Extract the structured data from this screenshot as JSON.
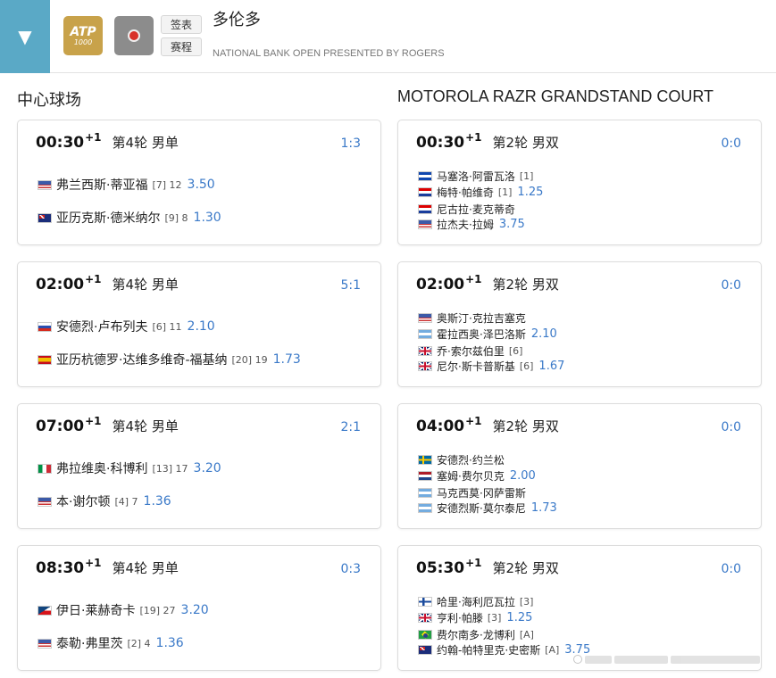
{
  "header": {
    "toggle_icon": "▼",
    "atp_logo_text": "ATP",
    "atp_logo_number": "1000",
    "draw_button": "签表",
    "schedule_button": "赛程",
    "city": "多伦多",
    "tournament": "NATIONAL BANK OPEN PRESENTED BY ROGERS"
  },
  "colors": {
    "accent": "#5aa9c6",
    "link": "#3a79c8",
    "atp_gold": "#c8a24a"
  },
  "courts": [
    {
      "title": "中心球场",
      "matches": [
        {
          "time": "00:30",
          "plus": "+1",
          "round": "第4轮 男单",
          "score": "1:3",
          "players": [
            {
              "flag": "us",
              "name": "弗兰西斯·蒂亚福",
              "seed": "[7] 12",
              "odds": "3.50"
            },
            {
              "flag": "au",
              "name": "亚历克斯·德米纳尔",
              "seed": "[9] 8",
              "odds": "1.30"
            }
          ]
        },
        {
          "time": "02:00",
          "plus": "+1",
          "round": "第4轮 男单",
          "score": "5:1",
          "players": [
            {
              "flag": "ru",
              "name": "安德烈·卢布列夫",
              "seed": "[6] 11",
              "odds": "2.10"
            },
            {
              "flag": "es",
              "name": "亚历杭德罗·达维多维奇-福基纳",
              "seed": "[20] 19",
              "odds": "1.73"
            }
          ]
        },
        {
          "time": "07:00",
          "plus": "+1",
          "round": "第4轮 男单",
          "score": "2:1",
          "players": [
            {
              "flag": "it",
              "name": "弗拉维奥·科博利",
              "seed": "[13] 17",
              "odds": "3.20"
            },
            {
              "flag": "us",
              "name": "本·谢尔顿",
              "seed": "[4] 7",
              "odds": "1.36"
            }
          ]
        },
        {
          "time": "08:30",
          "plus": "+1",
          "round": "第4轮 男单",
          "score": "0:3",
          "players": [
            {
              "flag": "cz",
              "name": "伊日·莱赫奇卡",
              "seed": "[19] 27",
              "odds": "3.20"
            },
            {
              "flag": "us",
              "name": "泰勒·弗里茨",
              "seed": "[2] 4",
              "odds": "1.36"
            }
          ]
        }
      ]
    },
    {
      "title": "MOTOROLA RAZR GRANDSTAND COURT",
      "matches": [
        {
          "time": "00:30",
          "plus": "+1",
          "round": "第2轮 男双",
          "score": "0:0",
          "players": [
            {
              "flag": "sv",
              "name": "马塞洛·阿雷瓦洛",
              "seed": "[1]",
              "odds": ""
            },
            {
              "flag": "hr",
              "name": "梅特·帕维奇",
              "seed": "[1]",
              "odds": "1.25"
            },
            {
              "flag": "hr",
              "name": "尼古拉·麦克蒂奇",
              "seed": "",
              "odds": ""
            },
            {
              "flag": "us",
              "name": "拉杰夫·拉姆",
              "seed": "",
              "odds": "3.75"
            }
          ]
        },
        {
          "time": "02:00",
          "plus": "+1",
          "round": "第2轮 男双",
          "score": "0:0",
          "players": [
            {
              "flag": "us",
              "name": "奥斯汀·克拉吉塞克",
              "seed": "",
              "odds": ""
            },
            {
              "flag": "ar",
              "name": "霍拉西奥·泽巴洛斯",
              "seed": "",
              "odds": "2.10"
            },
            {
              "flag": "gb",
              "name": "乔·索尔兹伯里",
              "seed": "[6]",
              "odds": ""
            },
            {
              "flag": "gb",
              "name": "尼尔·斯卡普斯基",
              "seed": "[6]",
              "odds": "1.67"
            }
          ]
        },
        {
          "time": "04:00",
          "plus": "+1",
          "round": "第2轮 男双",
          "score": "0:0",
          "players": [
            {
              "flag": "se",
              "name": "安德烈·约兰松",
              "seed": "",
              "odds": ""
            },
            {
              "flag": "nl",
              "name": "塞姆·费尔贝克",
              "seed": "",
              "odds": "2.00"
            },
            {
              "flag": "ar",
              "name": "马克西莫·冈萨雷斯",
              "seed": "",
              "odds": ""
            },
            {
              "flag": "ar",
              "name": "安德烈斯·莫尔泰尼",
              "seed": "",
              "odds": "1.73"
            }
          ]
        },
        {
          "time": "05:30",
          "plus": "+1",
          "round": "第2轮 男双",
          "score": "0:0",
          "players": [
            {
              "flag": "fi",
              "name": "哈里·海利厄瓦拉",
              "seed": "[3]",
              "odds": ""
            },
            {
              "flag": "gb",
              "name": "亨利·帕滕",
              "seed": "[3]",
              "odds": "1.25"
            },
            {
              "flag": "br",
              "name": "费尔南多·龙博利",
              "seed": "[A]",
              "odds": ""
            },
            {
              "flag": "au",
              "name": "约翰-帕特里克·史密斯",
              "seed": "[A]",
              "odds": "3.75"
            }
          ]
        }
      ]
    }
  ]
}
